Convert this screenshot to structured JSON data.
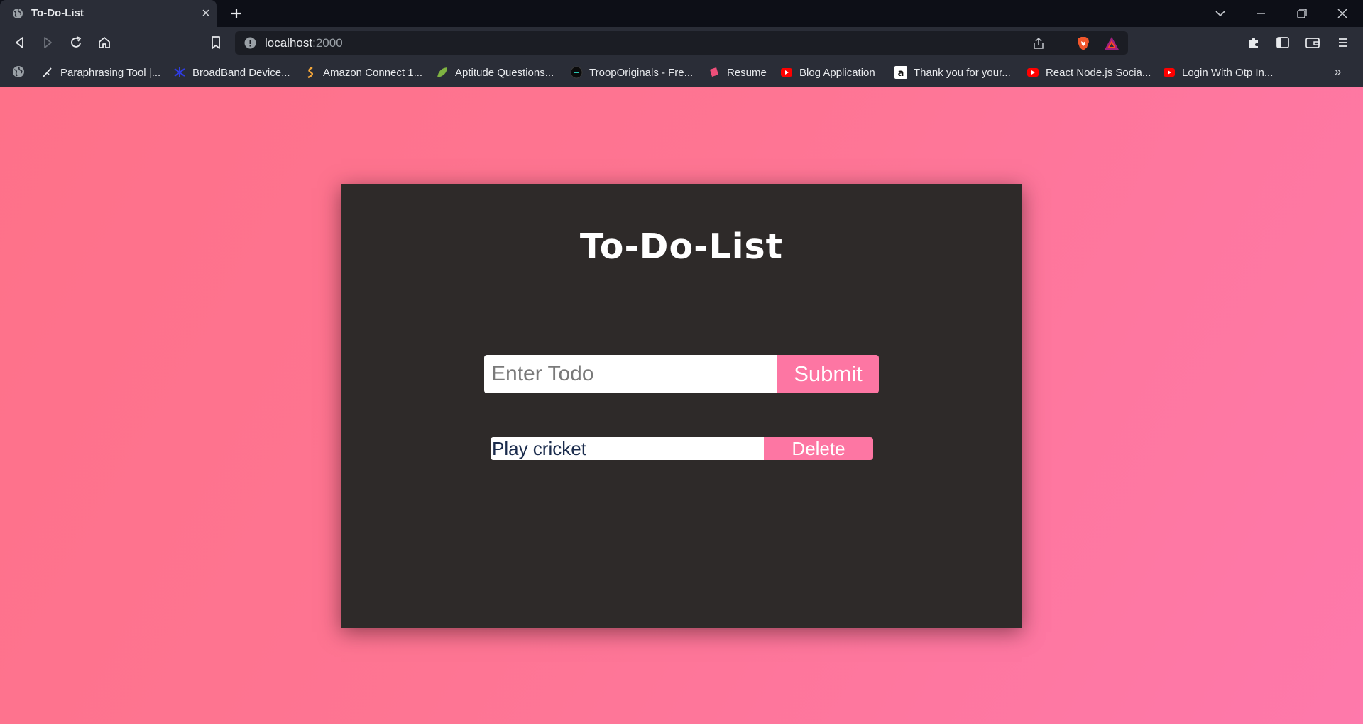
{
  "browser": {
    "tab": {
      "title": "To-Do-List"
    },
    "address": {
      "host": "localhost",
      "port": ":2000"
    },
    "bookmarks": [
      {
        "label": "Paraphrasing Tool |...",
        "icon": "quill-icon"
      },
      {
        "label": "BroadBand Device...",
        "icon": "device-icon"
      },
      {
        "label": "Amazon Connect 1...",
        "icon": "swirl-icon"
      },
      {
        "label": "Aptitude Questions...",
        "icon": "leaf-icon"
      },
      {
        "label": "TroopOriginals - Fre...",
        "icon": "troop-icon"
      },
      {
        "label": "Resume",
        "icon": "resume-icon"
      },
      {
        "label": "Blog Application",
        "icon": "youtube-icon"
      },
      {
        "label": "Thank you for your...",
        "icon": "amazon-icon"
      },
      {
        "label": "React Node.js Socia...",
        "icon": "youtube-icon"
      },
      {
        "label": "Login With Otp In...",
        "icon": "youtube-icon"
      }
    ],
    "more_bookmarks": "»"
  },
  "app": {
    "title": "To-Do-List",
    "input_placeholder": "Enter Todo",
    "submit_label": "Submit",
    "todos": [
      {
        "text": "Play cricket",
        "delete_label": "Delete"
      }
    ]
  },
  "colors": {
    "page_gradient": [
      "#fe7189",
      "#fe79ab"
    ],
    "card": "#2e2a29",
    "accent": "#fd76a3"
  }
}
